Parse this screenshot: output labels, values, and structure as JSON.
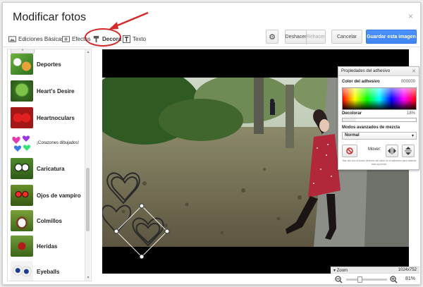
{
  "dialog": {
    "title": "Modificar fotos",
    "close": "×"
  },
  "toolbar": {
    "tabs": [
      {
        "label": "Ediciones Básicas",
        "icon": "photo-basic-icon"
      },
      {
        "label": "Efectos",
        "icon": "effects-icon"
      },
      {
        "label": "Decora",
        "icon": "brush-icon",
        "active": true
      },
      {
        "label": "Texto",
        "icon": "text-icon"
      }
    ],
    "settings_icon": "gear-icon",
    "undo": "Deshacer",
    "redo": "Rehacer",
    "cancel": "Cancelar",
    "save": "Guardar esta imagen"
  },
  "stickers": {
    "items": [
      {
        "label": "Deportes"
      },
      {
        "label": "Heart's Desire"
      },
      {
        "label": "Heartnoculars"
      },
      {
        "label": "¡Corazones dibujados!"
      },
      {
        "label": "Caricatura"
      },
      {
        "label": "Ojos de vampiro"
      },
      {
        "label": "Colmillos"
      },
      {
        "label": "Heridas"
      },
      {
        "label": "Eyeballs"
      }
    ]
  },
  "properties": {
    "title": "Propiedades del adhesivo",
    "color_label": "Color del adhesivo",
    "color_value": "000000",
    "decolor_label": "Decolorar",
    "decolor_value": "18%",
    "blend_label": "Modos avanzados de mezcla",
    "blend_value": "Normal",
    "move_label": "Mover:",
    "footnote": "Haz clic con el botón derecho del ratón en el adhesivo para obtener más opciones."
  },
  "zoom": {
    "label": "Zoom",
    "size": "1024x752",
    "percent": "81%",
    "level": 0.81
  },
  "colors": {
    "accent": "#4d90fe",
    "highlight": "#d32a2a"
  }
}
